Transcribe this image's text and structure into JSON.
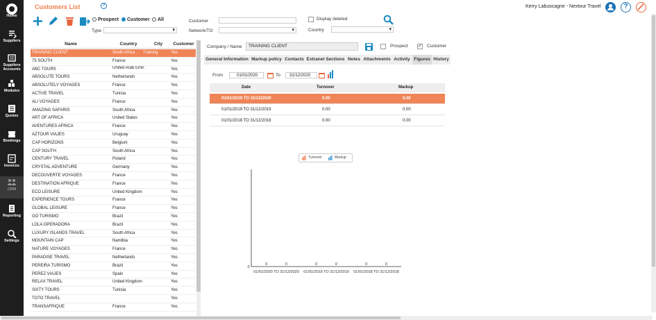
{
  "app": {
    "title": "Customers List",
    "user": "Kerry Labuscagne - Nextour Travel",
    "help_glyph": "?"
  },
  "colors": {
    "accent": "#ef8457",
    "title": "#f08050",
    "blue": "#1a73b8",
    "add": "#1a8abf",
    "delete": "#e8643c",
    "sidebar": "#1e1e1e"
  },
  "sidebar": {
    "items": [
      {
        "label": "Home",
        "icon": "home-icon"
      },
      {
        "label": "Suppliers",
        "icon": "suppliers-icon"
      },
      {
        "label": "Suppliers Accounts",
        "icon": "supplier-accounts-icon"
      },
      {
        "label": "Modules",
        "icon": "modules-icon"
      },
      {
        "label": "Quotes",
        "icon": "quotes-icon"
      },
      {
        "label": "Bookings",
        "icon": "bookings-icon"
      },
      {
        "label": "Invoices",
        "icon": "invoices-icon"
      },
      {
        "label": "CRM",
        "icon": "crm-icon"
      },
      {
        "label": "Reporting",
        "icon": "reporting-icon"
      },
      {
        "label": "Settings",
        "icon": "settings-icon"
      }
    ]
  },
  "filters": {
    "prospect": "Prospect",
    "customer": "Customer",
    "all": "All",
    "type_label": "Type",
    "customer_label": "Customer",
    "network_label": "Network/TO",
    "display_deleted": "Display deleted",
    "country_label": "Country"
  },
  "list": {
    "headers": {
      "name": "Name",
      "country": "Country",
      "city": "City",
      "customer": "Customer"
    },
    "rows": [
      {
        "name": "TRAINING CLIENT",
        "country": "South Africa",
        "city": "Training",
        "customer": "Yes"
      },
      {
        "name": "75 SOUTH",
        "country": "France",
        "city": "",
        "customer": "Yes"
      },
      {
        "name": "ABC TOURS",
        "country": "United Arab Emirates",
        "city": "",
        "customer": "Yes"
      },
      {
        "name": "ABSOLUTE TOURS",
        "country": "Netherlands",
        "city": "",
        "customer": "Yes"
      },
      {
        "name": "ABSOLUTELY VOYAGES",
        "country": "France",
        "city": "",
        "customer": "Yes"
      },
      {
        "name": "ACTIVE TRAVEL",
        "country": "Tunisia",
        "city": "",
        "customer": "Yes"
      },
      {
        "name": "ALI VOYAGES",
        "country": "France",
        "city": "",
        "customer": "Yes"
      },
      {
        "name": "AMAZING SAFARIS",
        "country": "South Africa",
        "city": "",
        "customer": "Yes"
      },
      {
        "name": "ART OF AFRICA",
        "country": "United States",
        "city": "",
        "customer": "Yes"
      },
      {
        "name": "AVENTURES AFRICA",
        "country": "France",
        "city": "",
        "customer": "Yes"
      },
      {
        "name": "AZTOUR VIAJES",
        "country": "Uruguay",
        "city": "",
        "customer": "Yes"
      },
      {
        "name": "CAP HORIZONS",
        "country": "Belgium",
        "city": "",
        "customer": "Yes"
      },
      {
        "name": "CAP SOUTH",
        "country": "South Africa",
        "city": "",
        "customer": "Yes"
      },
      {
        "name": "CENTURY TRAVEL",
        "country": "Poland",
        "city": "",
        "customer": "Yes"
      },
      {
        "name": "CRYSTAL ADVENTURE",
        "country": "Germany",
        "city": "",
        "customer": "Yes"
      },
      {
        "name": "DECOUVERTE VOYAGES",
        "country": "France",
        "city": "",
        "customer": "Yes"
      },
      {
        "name": "DESTINATION AFRIQUE",
        "country": "France",
        "city": "",
        "customer": "Yes"
      },
      {
        "name": "ECO LEISURE",
        "country": "United Kingdom",
        "city": "",
        "customer": "Yes"
      },
      {
        "name": "EXPERIENCE TOURS",
        "country": "France",
        "city": "",
        "customer": "Yes"
      },
      {
        "name": "GLOBAL LEISURE",
        "country": "France",
        "city": "",
        "customer": "Yes"
      },
      {
        "name": "GO TURISMO",
        "country": "Brazil",
        "city": "",
        "customer": "Yes"
      },
      {
        "name": "LOLA OPERADORA",
        "country": "Brazil",
        "city": "",
        "customer": "Yes"
      },
      {
        "name": "LUXURY ISLANDS TRAVEL",
        "country": "South Africa",
        "city": "",
        "customer": "Yes"
      },
      {
        "name": "MOUNTAIN CAP",
        "country": "Namibia",
        "city": "",
        "customer": "Yes"
      },
      {
        "name": "NATURE VOYAGES",
        "country": "France",
        "city": "",
        "customer": "Yes"
      },
      {
        "name": "PARADISE TRAVEL",
        "country": "Netherlands",
        "city": "",
        "customer": "Yes"
      },
      {
        "name": "PEREIRA TURISMO",
        "country": "Brazil",
        "city": "",
        "customer": "Yes"
      },
      {
        "name": "PEREZ VIAJES",
        "country": "Spain",
        "city": "",
        "customer": "Yes"
      },
      {
        "name": "RELAX TRAVEL",
        "country": "United Kingdom",
        "city": "",
        "customer": "Yes"
      },
      {
        "name": "SIXTY TOURS",
        "country": "Tunisia",
        "city": "",
        "customer": "Yes"
      },
      {
        "name": "TOTO TRAVEL",
        "country": "",
        "city": "",
        "customer": "Yes"
      },
      {
        "name": "TRANSAFRIQUE",
        "country": "France",
        "city": "",
        "customer": "Yes"
      }
    ]
  },
  "detail": {
    "company_label": "Company / Name",
    "company_value": "TRAINING CLIENT",
    "prospect_label": "Prospect",
    "customer_label": "Customer",
    "tabs": [
      "General Information",
      "Markup policy",
      "Contacts",
      "Extranet Sections",
      "Notes",
      "Attachments",
      "Activity",
      "Figures",
      "History"
    ],
    "active_tab": "Figures",
    "from_label": "From",
    "from_value": "01/01/2020",
    "to_label": "To",
    "to_value": "31/12/2020",
    "table_headers": {
      "date": "Date",
      "turnover": "Turnover",
      "markup": "Markup"
    },
    "table_rows": [
      {
        "date": "01/01/2020 TO 31/12/2020",
        "turnover": "0.00",
        "markup": "0.00"
      },
      {
        "date": "01/01/2019 TO 31/12/2019",
        "turnover": "0.00",
        "markup": "0.00"
      },
      {
        "date": "01/01/2018 TO 31/12/2018",
        "turnover": "0.00",
        "markup": "0.00"
      }
    ]
  },
  "chart_data": {
    "type": "bar",
    "categories": [
      "01/01/2020 TO 31/12/2020",
      "01/01/2019 TO 31/12/2019",
      "01/01/2018 TO 31/12/2018"
    ],
    "series": [
      {
        "name": "Turnover",
        "values": [
          0,
          0,
          0
        ]
      },
      {
        "name": "Markup",
        "values": [
          0,
          0,
          0
        ]
      }
    ],
    "value_labels": [
      "0",
      "0",
      "0",
      "0",
      "0",
      "0"
    ],
    "y_tick": "0",
    "legend_position": "top"
  }
}
